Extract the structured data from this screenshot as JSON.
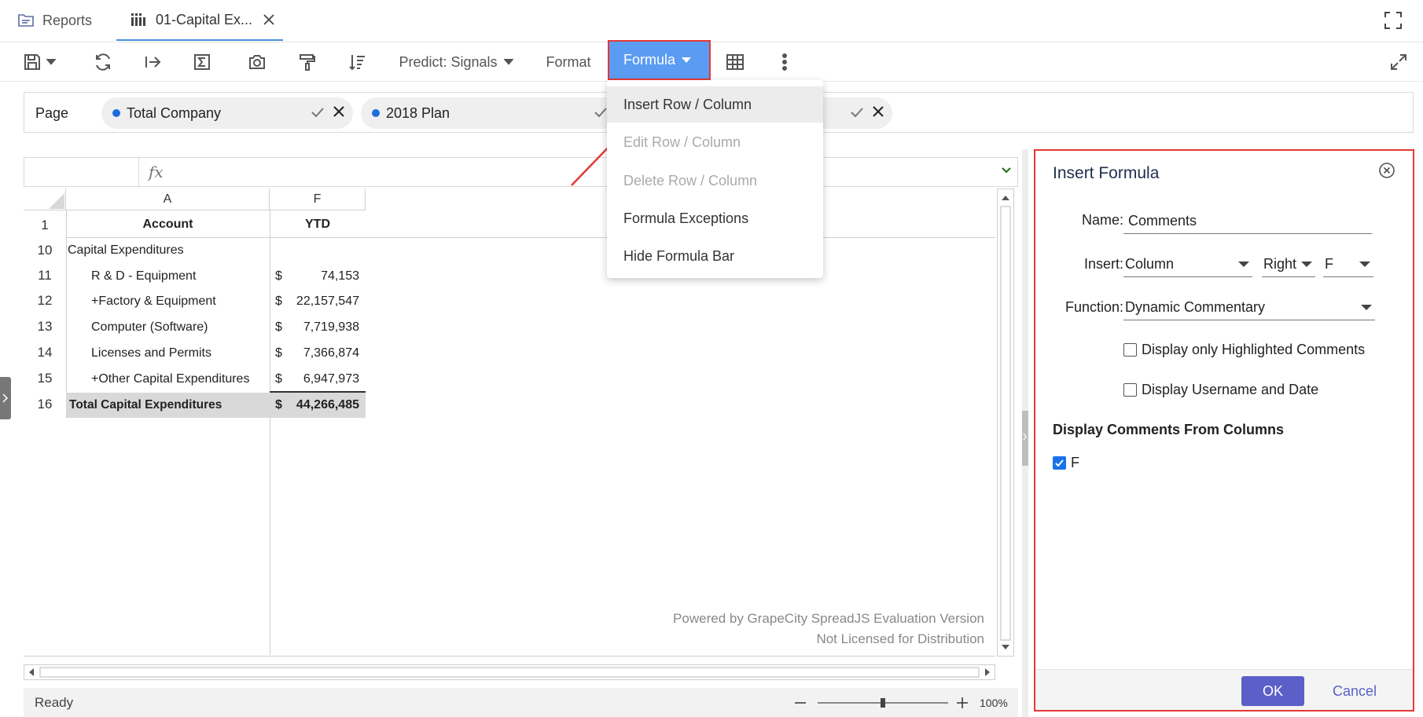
{
  "tabs": [
    {
      "label": "Reports",
      "icon": "report-icon"
    },
    {
      "label": "01-Capital Ex...",
      "icon": "grid-report-icon"
    }
  ],
  "toolbar": {
    "predict_label": "Predict: Signals",
    "format_label": "Format",
    "formula_label": "Formula"
  },
  "page": {
    "label": "Page",
    "chips": [
      {
        "label": "Total Company"
      },
      {
        "label": "2018 Plan"
      }
    ]
  },
  "formula_menu": [
    {
      "label": "Insert Row / Column",
      "state": "active"
    },
    {
      "label": "Edit Row / Column",
      "state": "disabled"
    },
    {
      "label": "Delete Row / Column",
      "state": "disabled"
    },
    {
      "label": "Formula Exceptions",
      "state": "enabled"
    },
    {
      "label": "Hide Formula Bar",
      "state": "enabled"
    }
  ],
  "sheet": {
    "columns": [
      "A",
      "F"
    ],
    "header_row": {
      "row": "1",
      "a": "Account",
      "f": "YTD"
    },
    "rows": [
      {
        "row": "10",
        "account": "Capital Expenditures",
        "currency": "",
        "value": ""
      },
      {
        "row": "11",
        "account": "R & D - Equipment",
        "currency": "$",
        "value": "74,153"
      },
      {
        "row": "12",
        "account": "+Factory & Equipment",
        "currency": "$",
        "value": "22,157,547"
      },
      {
        "row": "13",
        "account": "Computer (Software)",
        "currency": "$",
        "value": "7,719,938"
      },
      {
        "row": "14",
        "account": "Licenses and Permits",
        "currency": "$",
        "value": "7,366,874"
      },
      {
        "row": "15",
        "account": "+Other Capital Expenditures",
        "currency": "$",
        "value": "6,947,973"
      },
      {
        "row": "16",
        "account": "Total Capital Expenditures",
        "currency": "$",
        "value": "44,266,485"
      }
    ],
    "watermark_line1": "Powered by GrapeCity SpreadJS Evaluation Version",
    "watermark_line2": "Not Licensed for Distribution"
  },
  "status": {
    "text": "Ready",
    "zoom": "100%"
  },
  "panel": {
    "title": "Insert Formula",
    "name_label": "Name:",
    "name_value": "Comments",
    "insert_label": "Insert:",
    "insert_type": "Column",
    "insert_position": "Right",
    "insert_column": "F",
    "function_label": "Function:",
    "function_value": "Dynamic Commentary",
    "cb_highlighted": "Display only Highlighted Comments",
    "cb_username": "Display Username and Date",
    "section_title": "Display Comments From Columns",
    "column_option": "F",
    "ok_label": "OK",
    "cancel_label": "Cancel"
  },
  "colors": {
    "accent": "#5b9cf2",
    "highlight_border": "#e53935",
    "ok_button": "#5b5fc7"
  }
}
